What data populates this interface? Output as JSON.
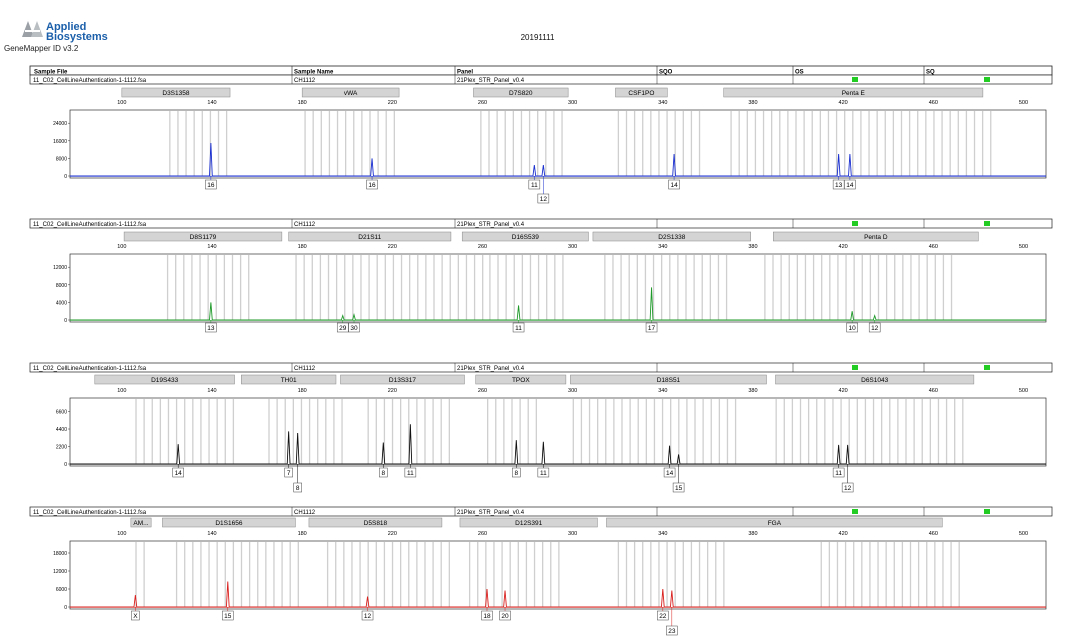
{
  "header": {
    "brand_line1": "Applied",
    "brand_line2": "Biosystems",
    "version": "GeneMapper ID v3.2",
    "run_date": "20191111"
  },
  "table_header": {
    "columns": [
      "Sample File",
      "Sample Name",
      "Panel",
      "SQO",
      "OS",
      "SQ"
    ]
  },
  "x_axis": {
    "ticks": [
      100,
      140,
      180,
      220,
      260,
      300,
      340,
      380,
      420,
      460,
      500
    ],
    "xlim": [
      77,
      510
    ]
  },
  "colors": {
    "blue": "#1a2fcf",
    "green": "#1f9a2a",
    "black": "#111111",
    "red": "#d9211f",
    "bin": "#cfcfcf",
    "marker_box": "#d4d4d4",
    "flag": "#22cc22"
  },
  "chart_data": [
    {
      "type": "line",
      "dye": "blue",
      "sample_file": "11_C02_CellLineAuthentication-1-1112.fsa",
      "sample_name": "CH1112",
      "panel": "21Plex_STR_Panel_v0.4",
      "y_ticks": [
        0,
        8000,
        16000,
        24000
      ],
      "ylim": [
        0,
        30000
      ],
      "markers": [
        {
          "name": "D3S1358",
          "range": [
            100,
            148
          ]
        },
        {
          "name": "vWA",
          "range": [
            180,
            223
          ]
        },
        {
          "name": "D7S820",
          "range": [
            256,
            298
          ]
        },
        {
          "name": "CSF1PO",
          "range": [
            319,
            342
          ]
        },
        {
          "name": "Penta E",
          "range": [
            367,
            482
          ]
        }
      ],
      "bins": [
        [
          121,
          148
        ],
        [
          181,
          223
        ],
        [
          259,
          298
        ],
        [
          320,
          357
        ],
        [
          370,
          487
        ]
      ],
      "peaks": [
        {
          "size": 139.5,
          "height": 15000,
          "label": "16"
        },
        {
          "size": 211,
          "height": 8000,
          "label": "16"
        },
        {
          "size": 283,
          "height": 5000,
          "label": "11"
        },
        {
          "size": 287,
          "height": 5000,
          "label": "12"
        },
        {
          "size": 345,
          "height": 10000,
          "label": "14"
        },
        {
          "size": 418,
          "height": 10000,
          "label": "13"
        },
        {
          "size": 423,
          "height": 10000,
          "label": "14"
        }
      ]
    },
    {
      "type": "line",
      "dye": "green",
      "sample_file": "11_C02_CellLineAuthentication-1-1112.fsa",
      "sample_name": "CH1112",
      "panel": "21Plex_STR_Panel_v0.4",
      "y_ticks": [
        0,
        4000,
        8000,
        12000
      ],
      "ylim": [
        0,
        15000
      ],
      "markers": [
        {
          "name": "D8S1179",
          "range": [
            101,
            171
          ]
        },
        {
          "name": "D21S11",
          "range": [
            174,
            246
          ]
        },
        {
          "name": "D16S539",
          "range": [
            251,
            307
          ]
        },
        {
          "name": "D2S1338",
          "range": [
            309,
            379
          ]
        },
        {
          "name": "Penta D",
          "range": [
            389,
            480
          ]
        }
      ],
      "bins": [
        [
          120,
          156
        ],
        [
          177,
          260
        ],
        [
          263,
          299
        ],
        [
          314,
          370
        ],
        [
          385,
          471
        ]
      ],
      "peaks": [
        {
          "size": 139.5,
          "height": 4000,
          "label": "13"
        },
        {
          "size": 198,
          "height": 1000,
          "label": "29"
        },
        {
          "size": 203,
          "height": 1200,
          "label": "30"
        },
        {
          "size": 276,
          "height": 3300,
          "label": "11"
        },
        {
          "size": 335,
          "height": 7400,
          "label": "17"
        },
        {
          "size": 424,
          "height": 2000,
          "label": "10"
        },
        {
          "size": 434,
          "height": 1000,
          "label": "12"
        }
      ]
    },
    {
      "type": "line",
      "dye": "black",
      "sample_file": "11_C02_CellLineAuthentication-1-1112.fsa",
      "sample_name": "CH1112",
      "panel": "21Plex_STR_Panel_v0.4",
      "y_ticks": [
        0,
        2200,
        4400,
        6600
      ],
      "ylim": [
        0,
        8300
      ],
      "markers": [
        {
          "name": "D19S433",
          "range": [
            88,
            150
          ]
        },
        {
          "name": "TH01",
          "range": [
            153,
            195
          ]
        },
        {
          "name": "D13S317",
          "range": [
            197,
            252
          ]
        },
        {
          "name": "TPOX",
          "range": [
            257,
            297
          ]
        },
        {
          "name": "D18S51",
          "range": [
            299,
            386
          ]
        },
        {
          "name": "D6S1043",
          "range": [
            390,
            478
          ]
        }
      ],
      "bins": [
        [
          106,
          150
        ],
        [
          165,
          200
        ],
        [
          209,
          247
        ],
        [
          262,
          287
        ],
        [
          300,
          375
        ],
        [
          390,
          476
        ]
      ],
      "peaks": [
        {
          "size": 125,
          "height": 2500,
          "label": "14"
        },
        {
          "size": 174,
          "height": 4100,
          "label": "7"
        },
        {
          "size": 178,
          "height": 3900,
          "label": "8"
        },
        {
          "size": 216,
          "height": 2700,
          "label": "8"
        },
        {
          "size": 228,
          "height": 5000,
          "label": "11"
        },
        {
          "size": 275,
          "height": 3000,
          "label": "8"
        },
        {
          "size": 287,
          "height": 2800,
          "label": "11"
        },
        {
          "size": 343,
          "height": 2300,
          "label": "14"
        },
        {
          "size": 347,
          "height": 1200,
          "label": "15"
        },
        {
          "size": 418,
          "height": 2400,
          "label": "11"
        },
        {
          "size": 422,
          "height": 2400,
          "label": "12"
        }
      ]
    },
    {
      "type": "line",
      "dye": "red",
      "sample_file": "11_C02_CellLineAuthentication-1-1112.fsa",
      "sample_name": "CH1112",
      "panel": "21Plex_STR_Panel_v0.4",
      "y_ticks": [
        0,
        6000,
        12000,
        18000
      ],
      "ylim": [
        0,
        22000
      ],
      "markers": [
        {
          "name": "AM...",
          "range": [
            104,
            113
          ]
        },
        {
          "name": "D1S1656",
          "range": [
            118,
            177
          ]
        },
        {
          "name": "D5S818",
          "range": [
            183,
            242
          ]
        },
        {
          "name": "D12S391",
          "range": [
            250,
            311
          ]
        },
        {
          "name": "FGA",
          "range": [
            315,
            464
          ]
        }
      ],
      "bins": [
        [
          106,
          110
        ],
        [
          124,
          179
        ],
        [
          191,
          247
        ],
        [
          254,
          296
        ],
        [
          320,
          367
        ],
        [
          410,
          472
        ]
      ],
      "peaks": [
        {
          "size": 106,
          "height": 4000,
          "label": "X"
        },
        {
          "size": 147,
          "height": 8500,
          "label": "15"
        },
        {
          "size": 209,
          "height": 3500,
          "label": "12"
        },
        {
          "size": 262,
          "height": 6000,
          "label": "18"
        },
        {
          "size": 270,
          "height": 5500,
          "label": "20"
        },
        {
          "size": 340,
          "height": 6000,
          "label": "22"
        },
        {
          "size": 344,
          "height": 5500,
          "label": "23"
        }
      ]
    }
  ]
}
